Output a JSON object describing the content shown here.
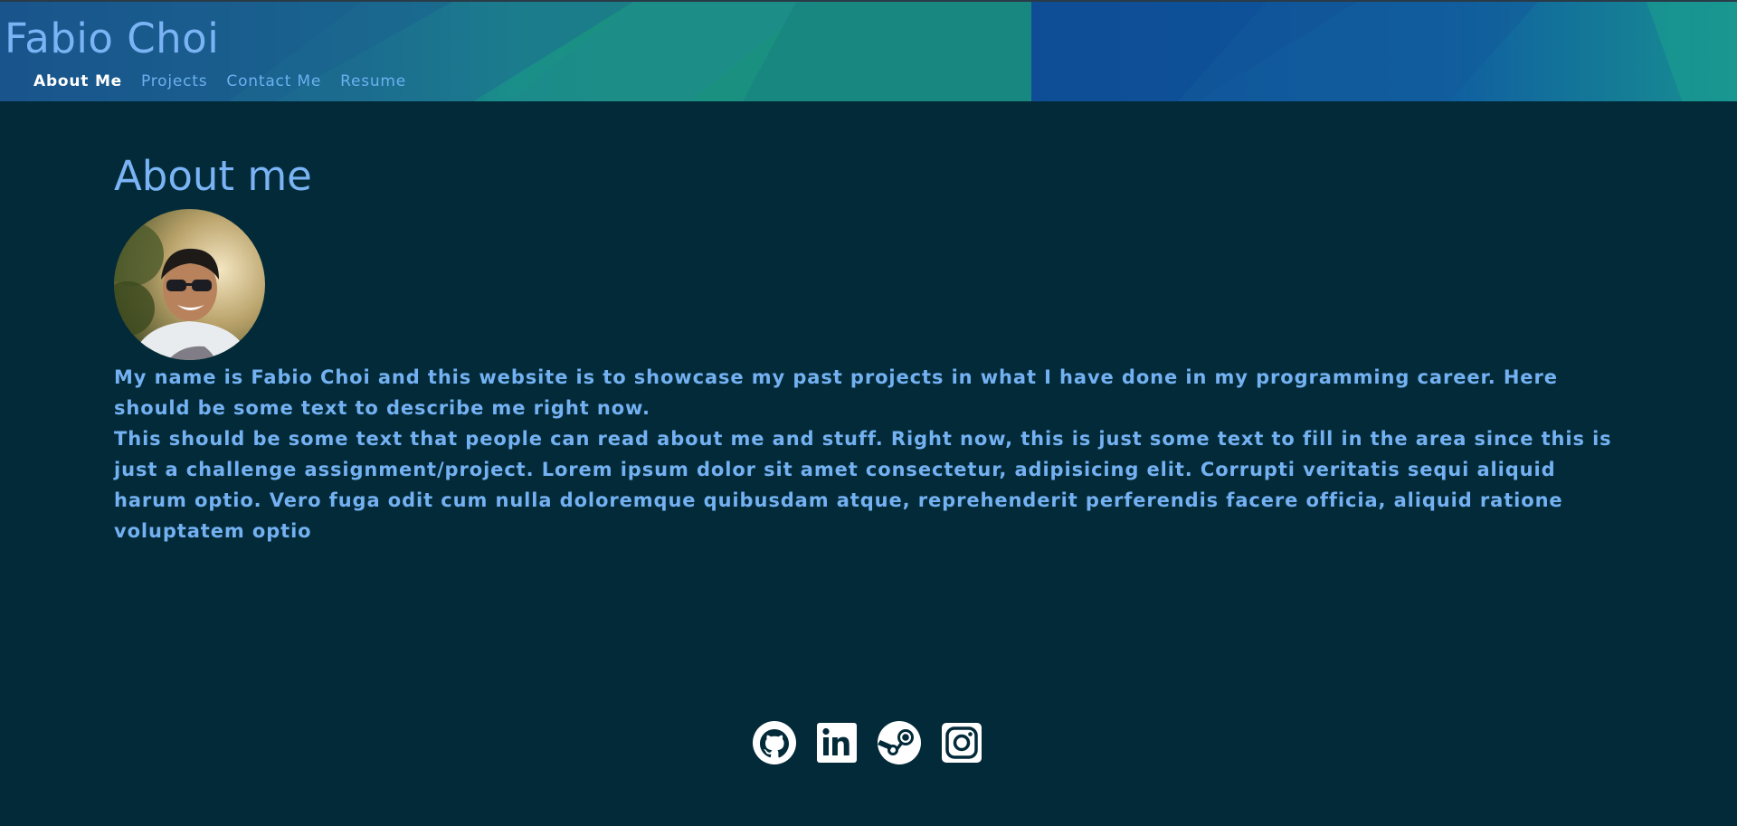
{
  "header": {
    "title": "Fabio Choi",
    "nav": [
      {
        "label": "About Me",
        "active": true
      },
      {
        "label": "Projects",
        "active": false
      },
      {
        "label": "Contact Me",
        "active": false
      },
      {
        "label": "Resume",
        "active": false
      }
    ]
  },
  "main": {
    "heading": "About me",
    "avatar_alt": "profile-photo",
    "paragraphs": [
      "My name is Fabio Choi and this website is to showcase my past projects in what I have done in my programming career. Here should be some text to describe me right now.",
      "This should be some text that people can read about me and stuff. Right now, this is just some text to fill in the area since this is just a challenge assignment/project. Lorem ipsum dolor sit amet consectetur, adipisicing elit. Corrupti veritatis sequi aliquid harum optio. Vero fuga odit cum nulla doloremque quibusdam atque, reprehenderit perferendis facere officia, aliquid ratione voluptatem optio"
    ]
  },
  "footer": {
    "social": [
      {
        "icon": "github-icon"
      },
      {
        "icon": "linkedin-icon"
      },
      {
        "icon": "steam-icon"
      },
      {
        "icon": "instagram-icon"
      }
    ]
  },
  "colors": {
    "background": "#022a38",
    "accent": "#7ab4f5",
    "nav_active": "#ffffff"
  }
}
